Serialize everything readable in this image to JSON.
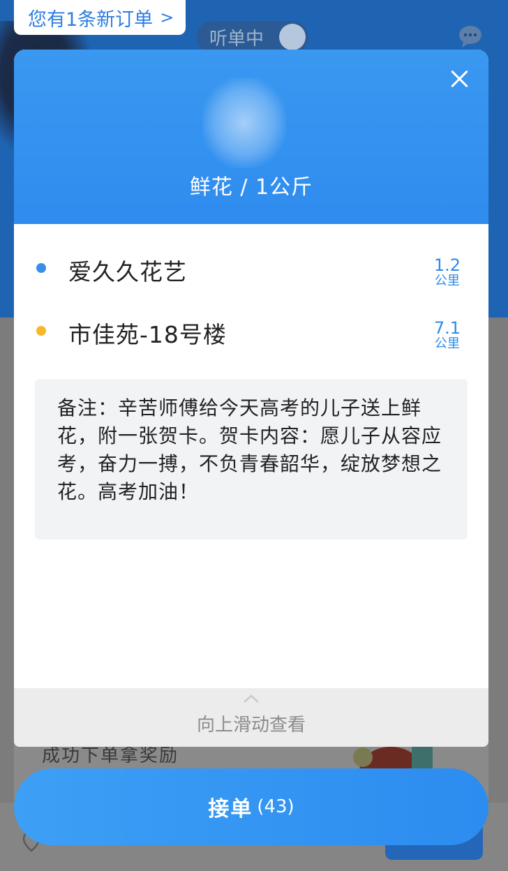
{
  "background": {
    "notification": "您有1条新订单",
    "status_pill": "听单中",
    "promo_text": "成功下单拿奖励"
  },
  "order": {
    "goods": "鲜花 / 1公斤",
    "pickup": {
      "name": "爱久久花艺",
      "distance": "1.2",
      "unit": "公里",
      "dot_color": "#3a8ee8"
    },
    "dropoff": {
      "name": "市佳苑-18号楼",
      "distance": "7.1",
      "unit": "公里",
      "dot_color": "#f5b829"
    },
    "note": "备注：辛苦师傅给今天高考的儿子送上鲜花，附一张贺卡。贺卡内容：愿儿子从容应考，奋力一搏，不负青春韶华，绽放梦想之花。高考加油！",
    "swipe_hint": "向上滑动查看"
  },
  "accept_button": {
    "label": "接单",
    "count": "(43)"
  },
  "colors": {
    "accent": "#2f8cef",
    "header": "#3a98f0"
  }
}
